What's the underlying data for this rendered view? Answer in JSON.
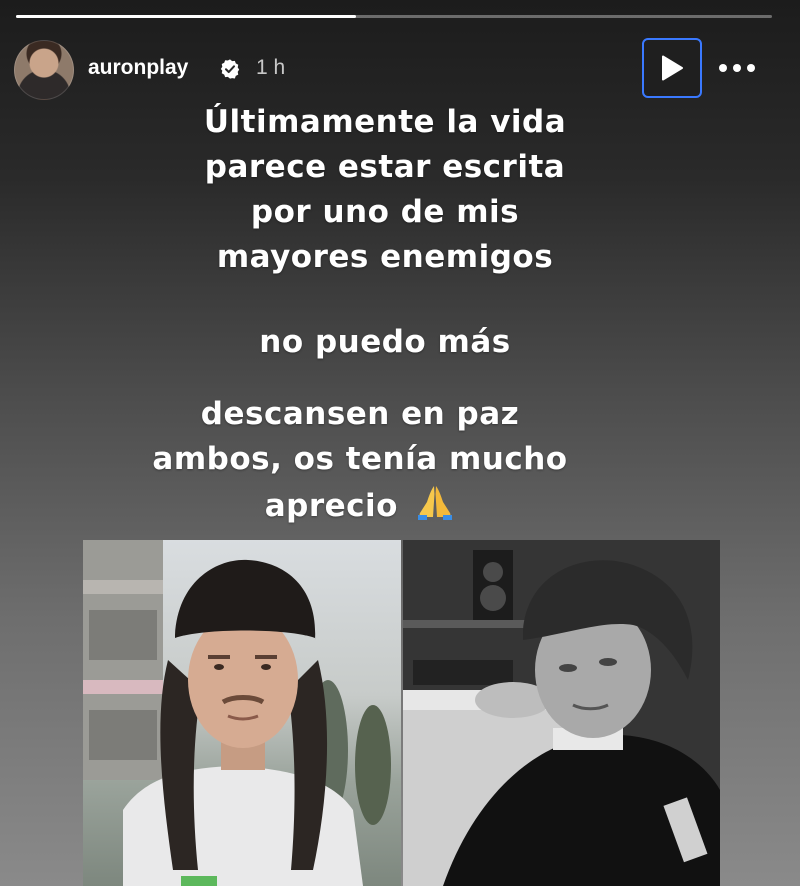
{
  "story": {
    "progress": 0.45,
    "colors": {
      "progress_fill": "#ffffff",
      "progress_track": "rgba(255,255,255,0.35)",
      "focus_ring": "#3a79ff",
      "verified_badge": "#ffffff"
    }
  },
  "header": {
    "username": "auronplay",
    "time_ago": "1 h",
    "avatar_icon": "profile-avatar",
    "verified_icon": "verified-badge-icon",
    "play_icon": "play-icon",
    "more_icon": "more-horizontal-icon"
  },
  "text_blocks": {
    "block1": [
      "Últimamente la vida",
      "parece estar escrita",
      "por uno de mis",
      "mayores enemigos"
    ],
    "block2": [
      "no puedo más"
    ],
    "block3": [
      "descansen en paz",
      "ambos, os tenía mucho",
      "aprecio"
    ],
    "emoji": "folded-hands-emoji"
  },
  "photos": {
    "left_icon": "person-photo-left",
    "right_icon": "person-photo-right"
  }
}
